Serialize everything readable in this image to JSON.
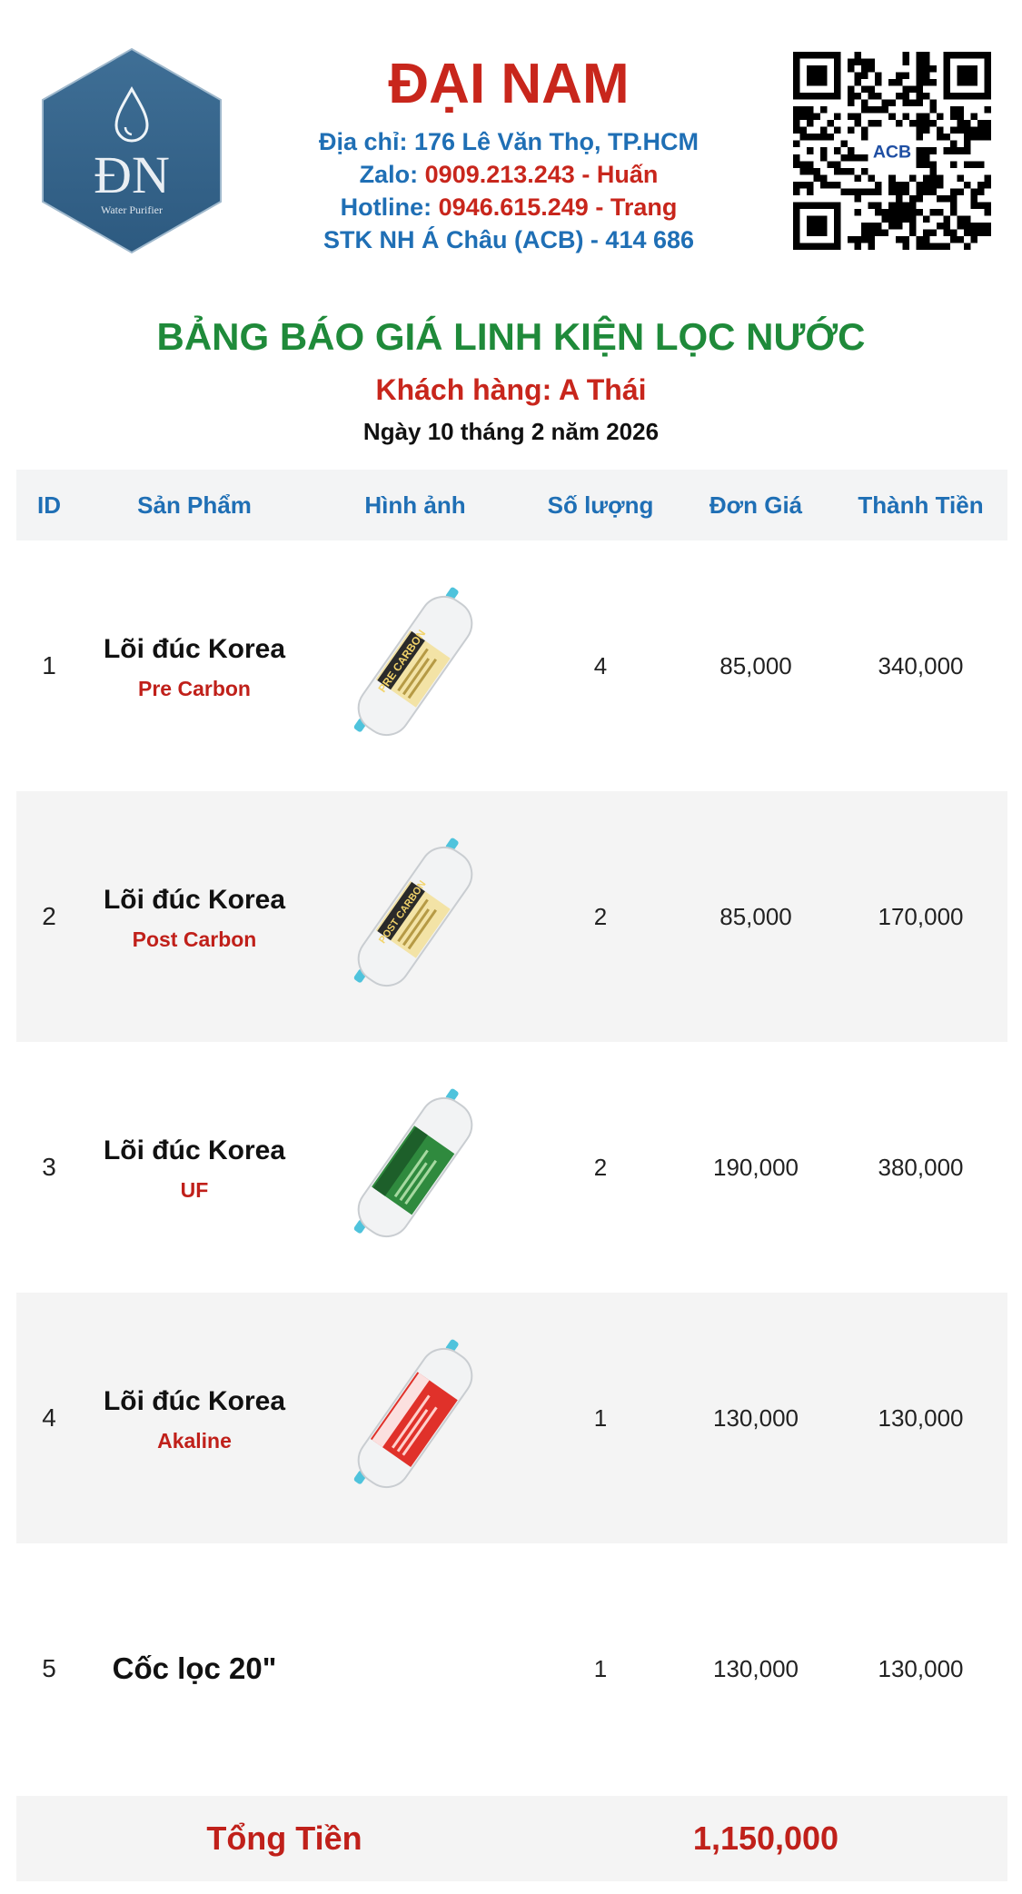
{
  "header": {
    "brand": "ĐẠI NAM",
    "address": "Địa chỉ: 176 Lê Văn Thọ, TP.HCM",
    "zalo_label": "Zalo: ",
    "zalo_value": "0909.213.243 - Huấn",
    "hotline_label": "Hotline: ",
    "hotline_value": "0946.615.249 - Trang",
    "bank": "STK NH Á Châu (ACB) - 414 686",
    "logo_text": "ĐN",
    "logo_sub": "Water Purifier",
    "qr_badge": "ACB"
  },
  "title": "BẢNG BÁO GIÁ LINH KIỆN LỌC NƯỚC",
  "customer": "Khách hàng: A Thái",
  "date": "Ngày 10 tháng 2 năm 2026",
  "table": {
    "headers": [
      "ID",
      "Sản Phẩm",
      "Hình ảnh",
      "Số lượng",
      "Đơn Giá",
      "Thành Tiền"
    ],
    "rows": [
      {
        "id": "1",
        "name": "Lõi đúc Korea",
        "sub": "Pre Carbon",
        "label": "PRE CARBON",
        "qty": "4",
        "unit": "85,000",
        "total": "340,000"
      },
      {
        "id": "2",
        "name": "Lõi đúc Korea",
        "sub": "Post Carbon",
        "label": "POST CARBON",
        "qty": "2",
        "unit": "85,000",
        "total": "170,000"
      },
      {
        "id": "3",
        "name": "Lõi đúc Korea",
        "sub": "UF",
        "label": "",
        "qty": "2",
        "unit": "190,000",
        "total": "380,000"
      },
      {
        "id": "4",
        "name": "Lõi đúc Korea",
        "sub": "Akaline",
        "label": "",
        "qty": "1",
        "unit": "130,000",
        "total": "130,000"
      },
      {
        "id": "5",
        "name": "Cốc lọc 20\"",
        "sub": "",
        "qty": "1",
        "unit": "130,000",
        "total": "130,000"
      }
    ]
  },
  "total": {
    "label": "Tổng Tiền",
    "value": "1,150,000"
  },
  "colors": {
    "brand_red": "#c8261c",
    "info_blue": "#1f6fb5",
    "title_green": "#1f8a3a",
    "row_shade": "#f4f4f4"
  }
}
